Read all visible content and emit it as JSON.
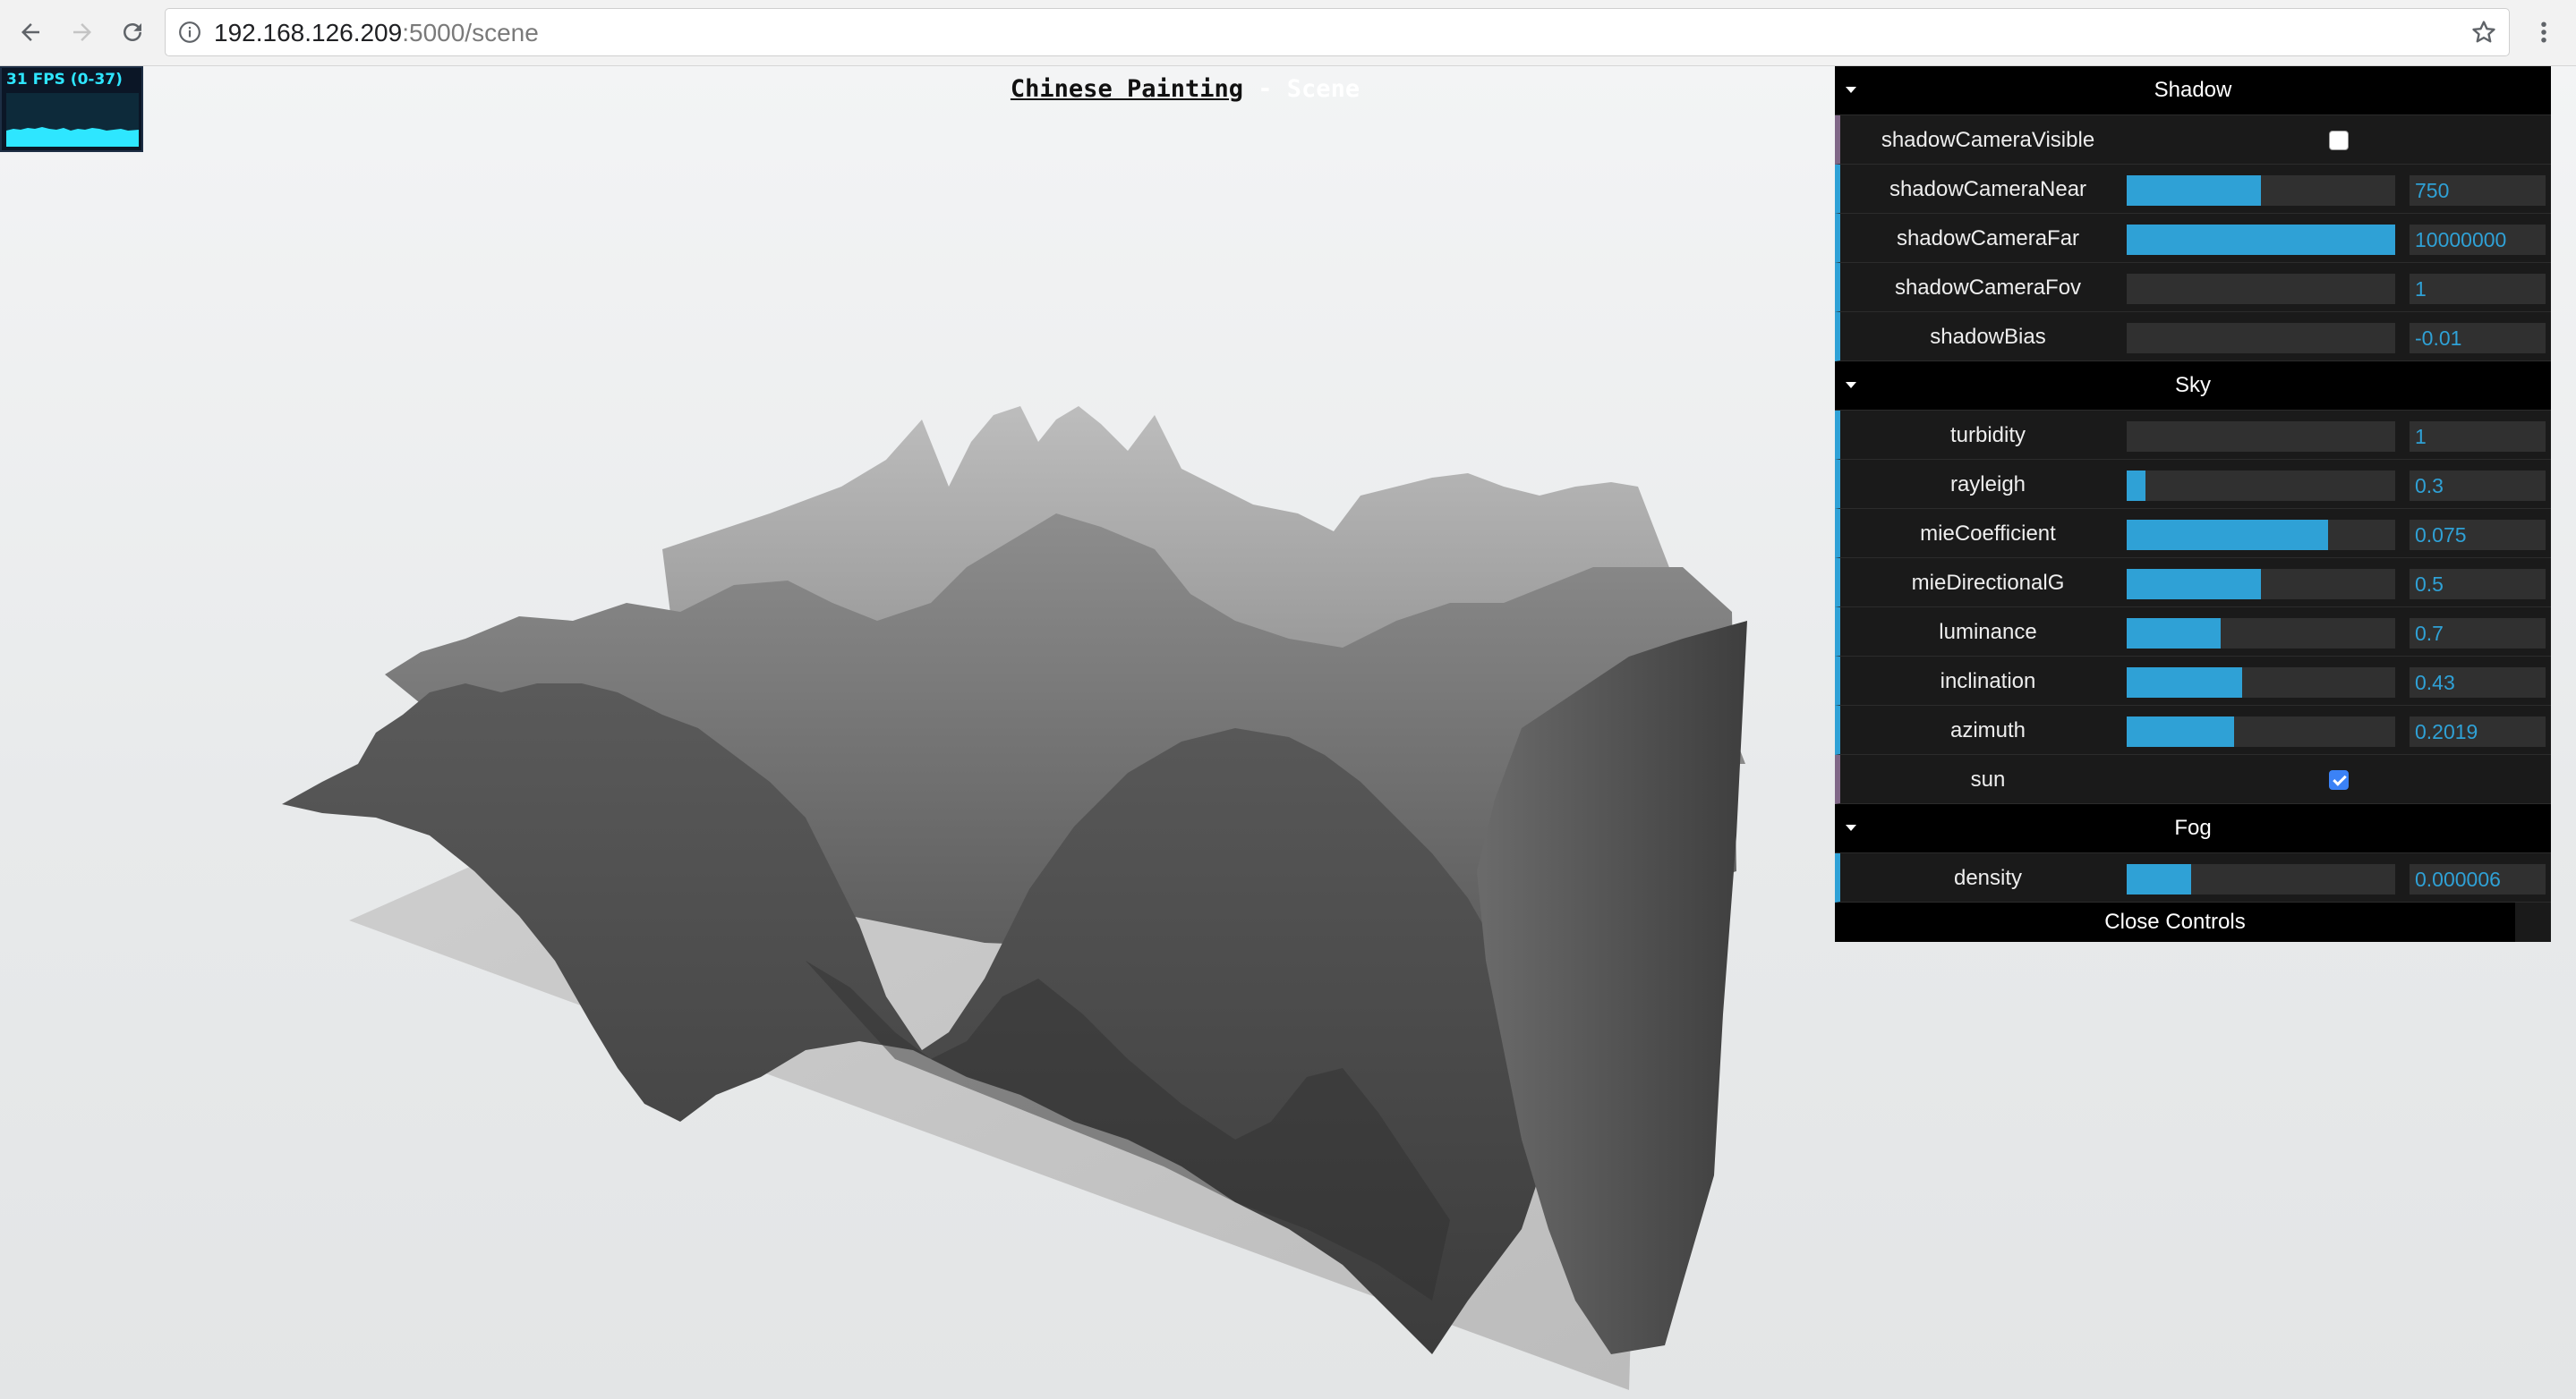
{
  "browser": {
    "url_host": "192.168.126.209",
    "url_path": ":5000/scene"
  },
  "fps": {
    "label": "31 FPS (0-37)"
  },
  "scene": {
    "title": "Chinese Painting",
    "separator": "-",
    "subtitle": "Scene"
  },
  "gui": {
    "close_label": "Close Controls",
    "accent_color": "#2fa1d6",
    "folders": {
      "shadow": {
        "title": "Shadow",
        "rows": {
          "shadowCameraVisible": {
            "label": "shadowCameraVisible",
            "checked": false
          },
          "shadowCameraNear": {
            "label": "shadowCameraNear",
            "value": "750",
            "fill": 0.5
          },
          "shadowCameraFar": {
            "label": "shadowCameraFar",
            "value": "10000000",
            "fill": 1.0
          },
          "shadowCameraFov": {
            "label": "shadowCameraFov",
            "value": "1",
            "fill": 0.0
          },
          "shadowBias": {
            "label": "shadowBias",
            "value": "-0.01",
            "fill": 0.0
          }
        }
      },
      "sky": {
        "title": "Sky",
        "rows": {
          "turbidity": {
            "label": "turbidity",
            "value": "1",
            "fill": 0.0
          },
          "rayleigh": {
            "label": "rayleigh",
            "value": "0.3",
            "fill": 0.07
          },
          "mieCoefficient": {
            "label": "mieCoefficient",
            "value": "0.075",
            "fill": 0.75
          },
          "mieDirectionalG": {
            "label": "mieDirectionalG",
            "value": "0.5",
            "fill": 0.5
          },
          "luminance": {
            "label": "luminance",
            "value": "0.7",
            "fill": 0.35
          },
          "inclination": {
            "label": "inclination",
            "value": "0.43",
            "fill": 0.43
          },
          "azimuth": {
            "label": "azimuth",
            "value": "0.2019",
            "fill": 0.4
          },
          "sun": {
            "label": "sun",
            "checked": true
          }
        }
      },
      "fog": {
        "title": "Fog",
        "rows": {
          "density": {
            "label": "density",
            "value": "0.000006",
            "fill": 0.24
          }
        }
      }
    }
  }
}
